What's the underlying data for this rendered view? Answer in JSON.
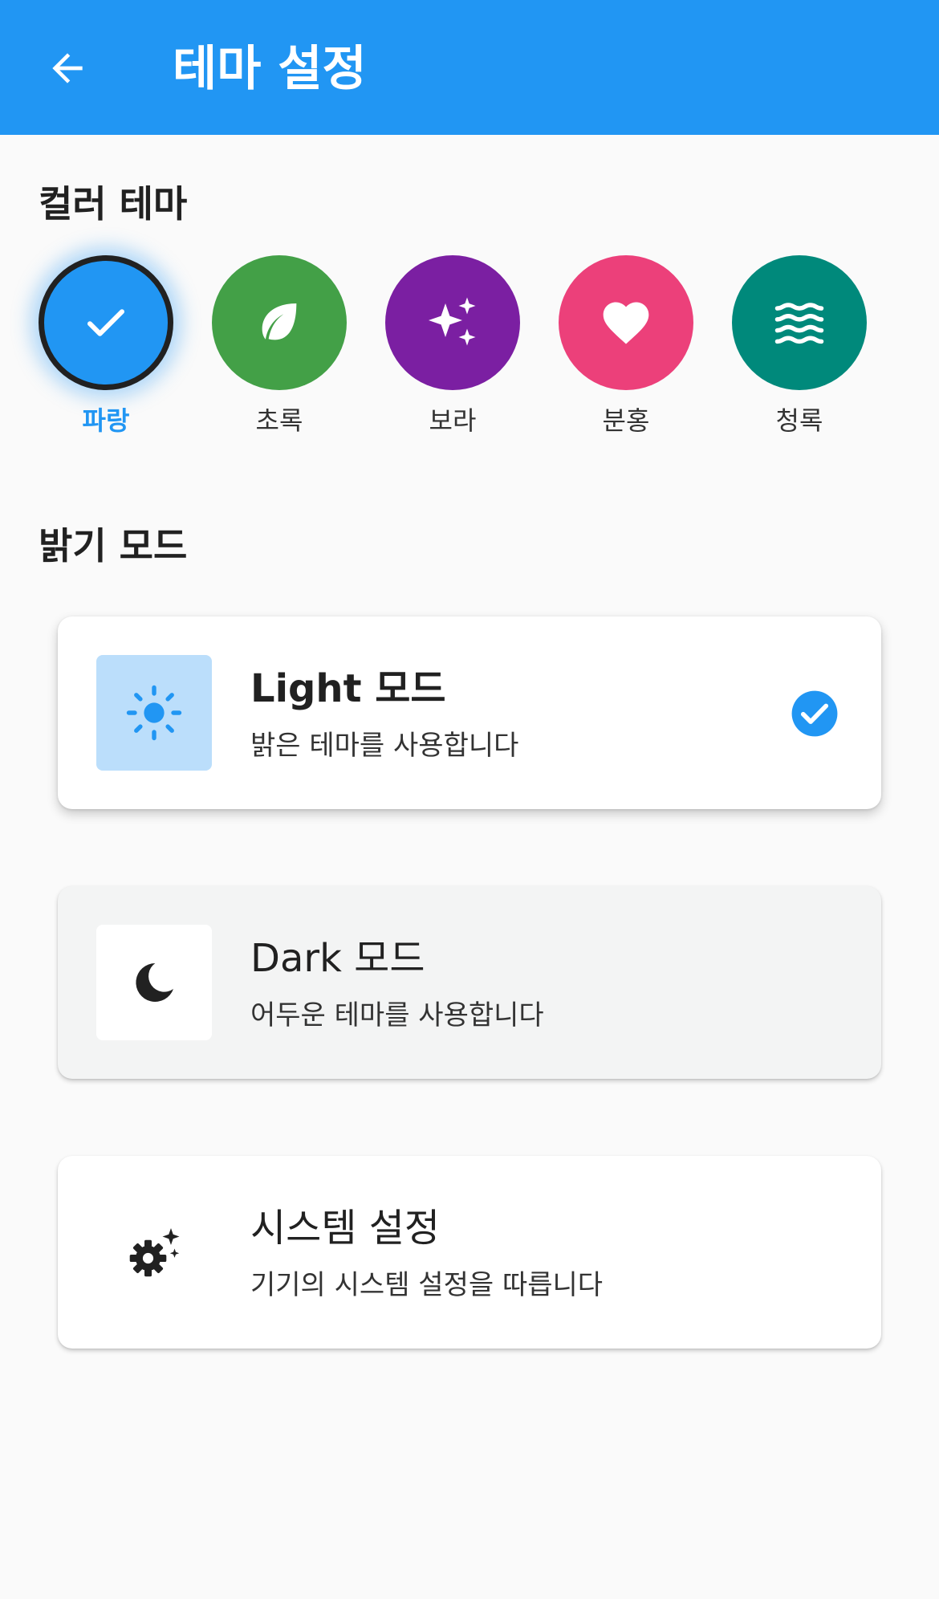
{
  "appbar": {
    "title": "테마 설정",
    "background": "#2196f3",
    "back_icon": "arrow-left-icon"
  },
  "color_theme": {
    "section_title": "컬러 테마",
    "selected": "파랑",
    "swatches": [
      {
        "label": "파랑",
        "color": "#2196f3",
        "icon": "check-icon"
      },
      {
        "label": "초록",
        "color": "#43a047",
        "icon": "leaf-icon"
      },
      {
        "label": "보라",
        "color": "#7b1fa2",
        "icon": "sparkles-icon"
      },
      {
        "label": "분홍",
        "color": "#ec407a",
        "icon": "heart-icon"
      },
      {
        "label": "청록",
        "color": "#00897b",
        "icon": "waves-icon"
      }
    ]
  },
  "brightness": {
    "section_title": "밝기 모드",
    "selected": "light",
    "options": [
      {
        "id": "light",
        "title": "Light 모드",
        "desc": "밝은 테마를 사용합니다",
        "icon": "sun-icon",
        "icon_bg": "#bbdefb",
        "icon_color": "#2196f3"
      },
      {
        "id": "dark",
        "title": "Dark 모드",
        "desc": "어두운 테마를 사용합니다",
        "icon": "moon-icon",
        "icon_bg": "#ffffff",
        "icon_color": "#212121"
      },
      {
        "id": "system",
        "title": "시스템 설정",
        "desc": "기기의 시스템 설정을 따릅니다",
        "icon": "gear-sparkle-icon",
        "icon_bg": "#ffffff",
        "icon_color": "#212121"
      }
    ]
  }
}
